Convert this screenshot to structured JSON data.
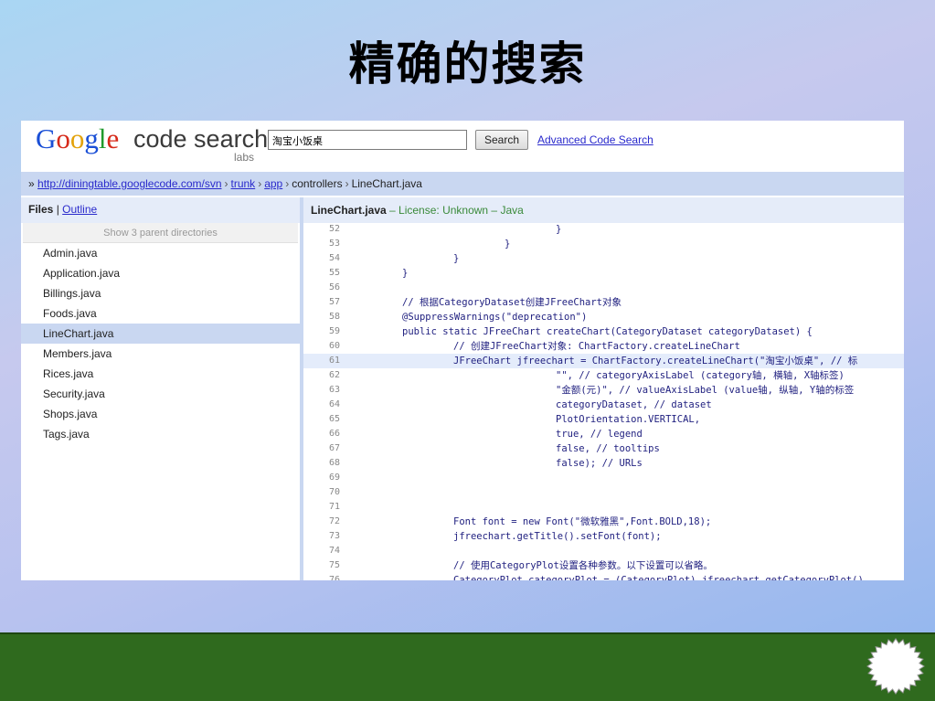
{
  "slide": {
    "title": "精确的搜索"
  },
  "header": {
    "logo_letters": [
      "G",
      "o",
      "o",
      "g",
      "l",
      "e"
    ],
    "product": "code search",
    "labs": "labs",
    "search_value": "淘宝小饭桌",
    "search_button": "Search",
    "advanced_link": "Advanced Code Search"
  },
  "breadcrumb": {
    "prefix": "»",
    "parts": [
      {
        "text": "http://diningtable.googlecode.com/svn",
        "link": true
      },
      {
        "text": "trunk",
        "link": true
      },
      {
        "text": "app",
        "link": true
      },
      {
        "text": "controllers",
        "link": false
      },
      {
        "text": "LineChart.java",
        "link": false
      }
    ],
    "separator": "›"
  },
  "sidebar": {
    "files_label": "Files",
    "divider": "|",
    "outline_label": "Outline",
    "parent_dirs": "Show 3 parent directories",
    "files": [
      {
        "name": "Admin.java",
        "selected": false
      },
      {
        "name": "Application.java",
        "selected": false
      },
      {
        "name": "Billings.java",
        "selected": false
      },
      {
        "name": "Foods.java",
        "selected": false
      },
      {
        "name": "LineChart.java",
        "selected": true
      },
      {
        "name": "Members.java",
        "selected": false
      },
      {
        "name": "Rices.java",
        "selected": false
      },
      {
        "name": "Security.java",
        "selected": false
      },
      {
        "name": "Shops.java",
        "selected": false
      },
      {
        "name": "Tags.java",
        "selected": false
      }
    ]
  },
  "code": {
    "filename": "LineChart.java",
    "license": " – License: Unknown – Java",
    "lines": [
      {
        "n": "52",
        "indent": 4,
        "text": "}"
      },
      {
        "n": "53",
        "indent": 3,
        "text": "}"
      },
      {
        "n": "54",
        "indent": 2,
        "text": "}"
      },
      {
        "n": "55",
        "indent": 1,
        "text": "}"
      },
      {
        "n": "56",
        "indent": 0,
        "text": ""
      },
      {
        "n": "57",
        "indent": 1,
        "text": "// 根据CategoryDataset创建JFreeChart对象"
      },
      {
        "n": "58",
        "indent": 1,
        "text": "@SuppressWarnings(\"deprecation\")"
      },
      {
        "n": "59",
        "indent": 1,
        "text": "public static JFreeChart createChart(CategoryDataset categoryDataset) {"
      },
      {
        "n": "60",
        "indent": 2,
        "text": "// 创建JFreeChart对象: ChartFactory.createLineChart"
      },
      {
        "n": "61",
        "indent": 2,
        "text": "JFreeChart jfreechart = ChartFactory.createLineChart(\"淘宝小饭桌\", // 标",
        "hl": true
      },
      {
        "n": "62",
        "indent": 4,
        "text": "\"\", // categoryAxisLabel (category轴, 横轴, X轴标签)"
      },
      {
        "n": "63",
        "indent": 4,
        "text": "\"金额(元)\", // valueAxisLabel (value轴, 纵轴, Y轴的标签"
      },
      {
        "n": "64",
        "indent": 4,
        "text": "categoryDataset, // dataset"
      },
      {
        "n": "65",
        "indent": 4,
        "text": "PlotOrientation.VERTICAL,"
      },
      {
        "n": "66",
        "indent": 4,
        "text": "true, // legend"
      },
      {
        "n": "67",
        "indent": 4,
        "text": "false, // tooltips"
      },
      {
        "n": "68",
        "indent": 4,
        "text": "false); // URLs"
      },
      {
        "n": "69",
        "indent": 0,
        "text": ""
      },
      {
        "n": "70",
        "indent": 0,
        "text": ""
      },
      {
        "n": "71",
        "indent": 0,
        "text": ""
      },
      {
        "n": "72",
        "indent": 2,
        "text": "Font font = new Font(\"微软雅黑\",Font.BOLD,18);"
      },
      {
        "n": "73",
        "indent": 2,
        "text": "jfreechart.getTitle().setFont(font);"
      },
      {
        "n": "74",
        "indent": 0,
        "text": ""
      },
      {
        "n": "75",
        "indent": 2,
        "text": "// 使用CategoryPlot设置各种参数。以下设置可以省略。"
      },
      {
        "n": "76",
        "indent": 2,
        "text": "CategoryPlot categoryPlot = (CategoryPlot) jfreechart.getCategoryPlot()"
      }
    ]
  },
  "colors": {
    "band": "#2f6a1e",
    "link": "#2a2acc",
    "crumb_bg": "#c9d7f1"
  }
}
